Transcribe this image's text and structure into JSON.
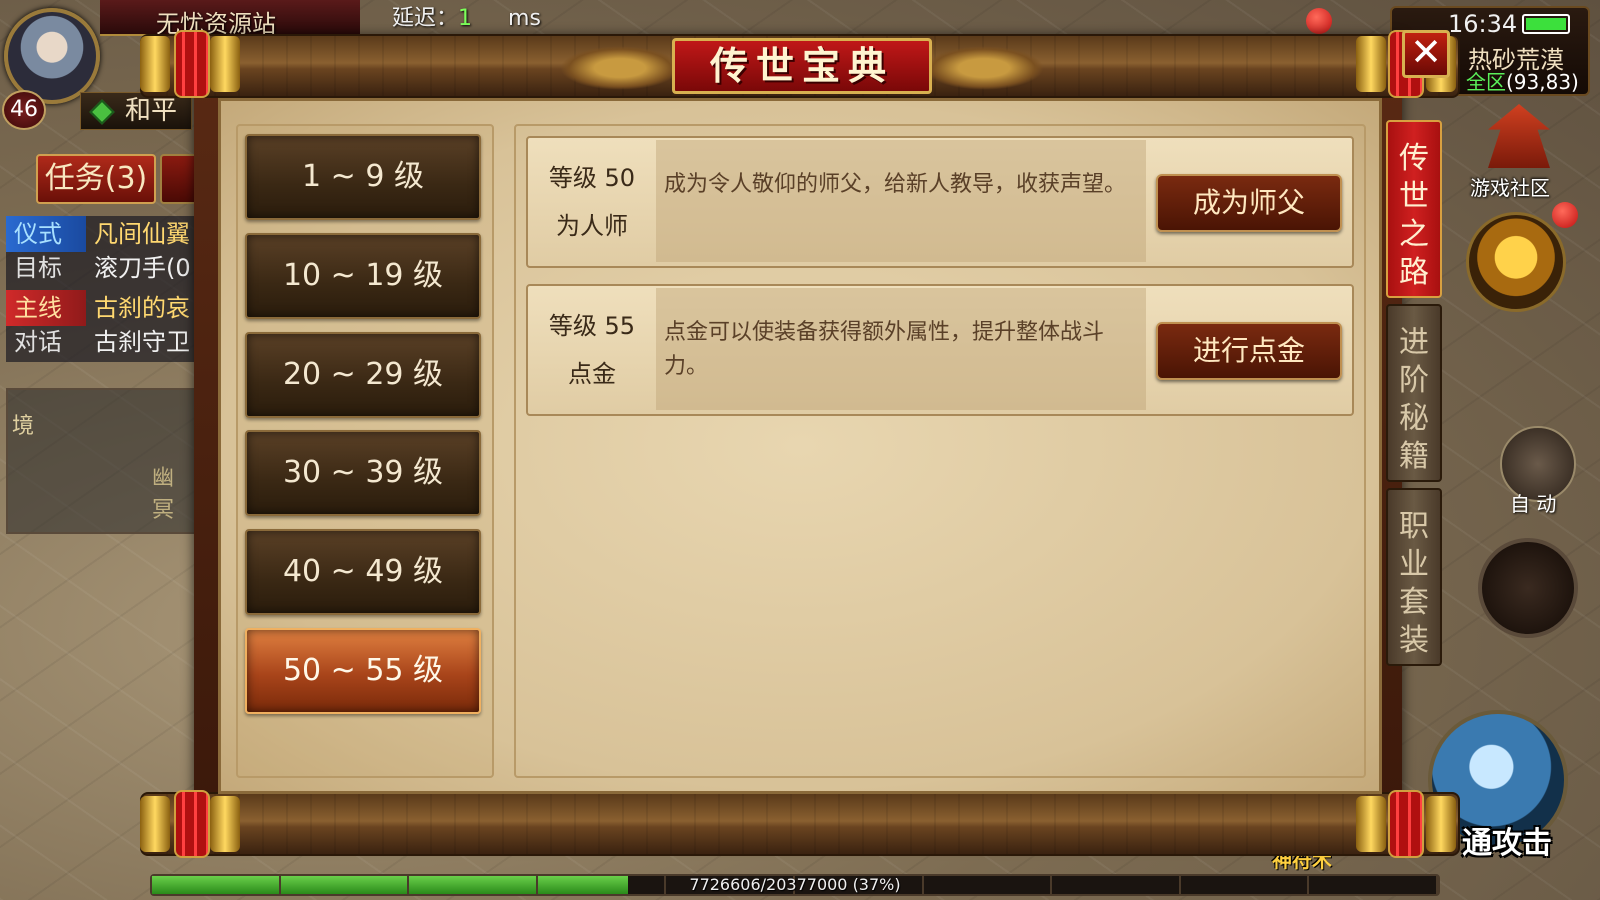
{
  "hud": {
    "server_name": "无忧资源站",
    "latency_label": "延迟：",
    "latency_value": "1",
    "latency_unit": "ms",
    "player_level": "46",
    "pk_mode": "和平",
    "task_tab": "任务(3)",
    "quests": [
      {
        "tag": "仪式",
        "text": "凡间仙翼",
        "tag_color": "blue"
      },
      {
        "tag": "目标",
        "text": "滚刀手(0",
        "tag_color": "plain"
      },
      {
        "tag": "主线",
        "text": "古刹的哀",
        "tag_color": "red"
      },
      {
        "tag": "对话",
        "text": "古刹守卫",
        "tag_color": "plain"
      }
    ],
    "minimap_left": {
      "label_1": "境",
      "label_2": "幽冥"
    },
    "time": "16:34",
    "map_name": "热砂荒漠",
    "map_zone": "全区",
    "map_coords": "(93,83)",
    "community": "游戏社区",
    "auto_label": "自 动",
    "attack_label": "通攻击",
    "bottom_tag": "神符术",
    "exp_text": "7726606/20377000 (37%)",
    "exp_progress": 0.37
  },
  "dialog": {
    "title": "传世宝典",
    "close_label": "✕",
    "level_ranges": [
      {
        "label": "1 ~ 9 级",
        "active": false
      },
      {
        "label": "10 ~ 19 级",
        "active": false
      },
      {
        "label": "20 ~ 29 级",
        "active": false
      },
      {
        "label": "30 ~ 39 级",
        "active": false
      },
      {
        "label": "40 ~ 49 级",
        "active": false
      },
      {
        "label": "50 ~ 55 级",
        "active": true
      }
    ],
    "entries": [
      {
        "level": "等级 50",
        "name": "为人师",
        "description": "成为令人敬仰的师父，给新人教导，收获声望。",
        "action": "成为师父"
      },
      {
        "level": "等级 55",
        "name": "点金",
        "description": "点金可以使装备获得额外属性，提升整体战斗力。",
        "action": "进行点金"
      }
    ],
    "side_tabs": [
      {
        "label": "传世之路",
        "active": true
      },
      {
        "label": "进阶秘籍",
        "active": false
      },
      {
        "label": "职业套装",
        "active": false
      }
    ]
  },
  "colors": {
    "accent_red": "#c01818",
    "active_tab_orange": "#e08040",
    "parchment": "#e8d6b0",
    "exp_green": "#6ad04a"
  }
}
